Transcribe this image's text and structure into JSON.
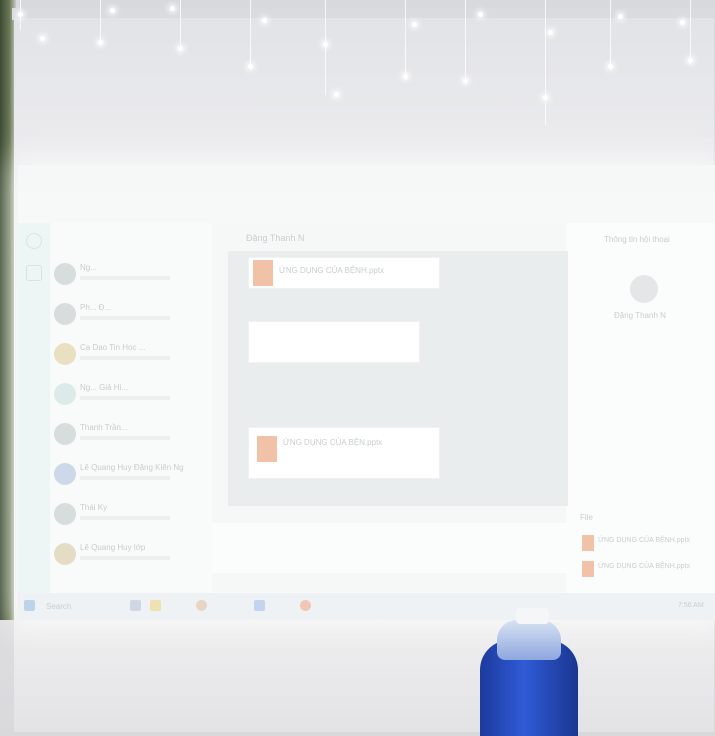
{
  "scene": {
    "description_kind": "photo of projected screen",
    "colors": {
      "wall": "#dfe0e3",
      "projection": "#fbfcfb",
      "bottle": "#2f5bd6"
    }
  },
  "app": {
    "header_name": "Đặng Thanh N",
    "file_card_title": "ỨNG DỤNG CỦA BỆNH.pptx",
    "attachment_title": "ỨNG DỤNG CỦA BỆN.pptx",
    "contacts": [
      {
        "name": "Ng..."
      },
      {
        "name": "Ph... Đ..."
      },
      {
        "name": "Ca Dao Tin Hoc ..."
      },
      {
        "name": "Ng... Giả Hi..."
      },
      {
        "name": "Thanh Trần..."
      },
      {
        "name": "Lê Quang Huy Đặng Kiên Ng"
      },
      {
        "name": "Thái Ky"
      },
      {
        "name": "Lê Quang Huy lớp"
      }
    ],
    "right_panel": {
      "title": "Thông tin hội thoại",
      "profile_name": "Đặng Thanh N",
      "files_label": "File",
      "files": [
        {
          "name": "ỨNG DỤNG CỦA BỆNH.pptx"
        },
        {
          "name": "ỨNG DỤNG CỦA BỆNH.pptx"
        }
      ]
    },
    "search_placeholder": "Search",
    "clock": "7:56 AM"
  }
}
